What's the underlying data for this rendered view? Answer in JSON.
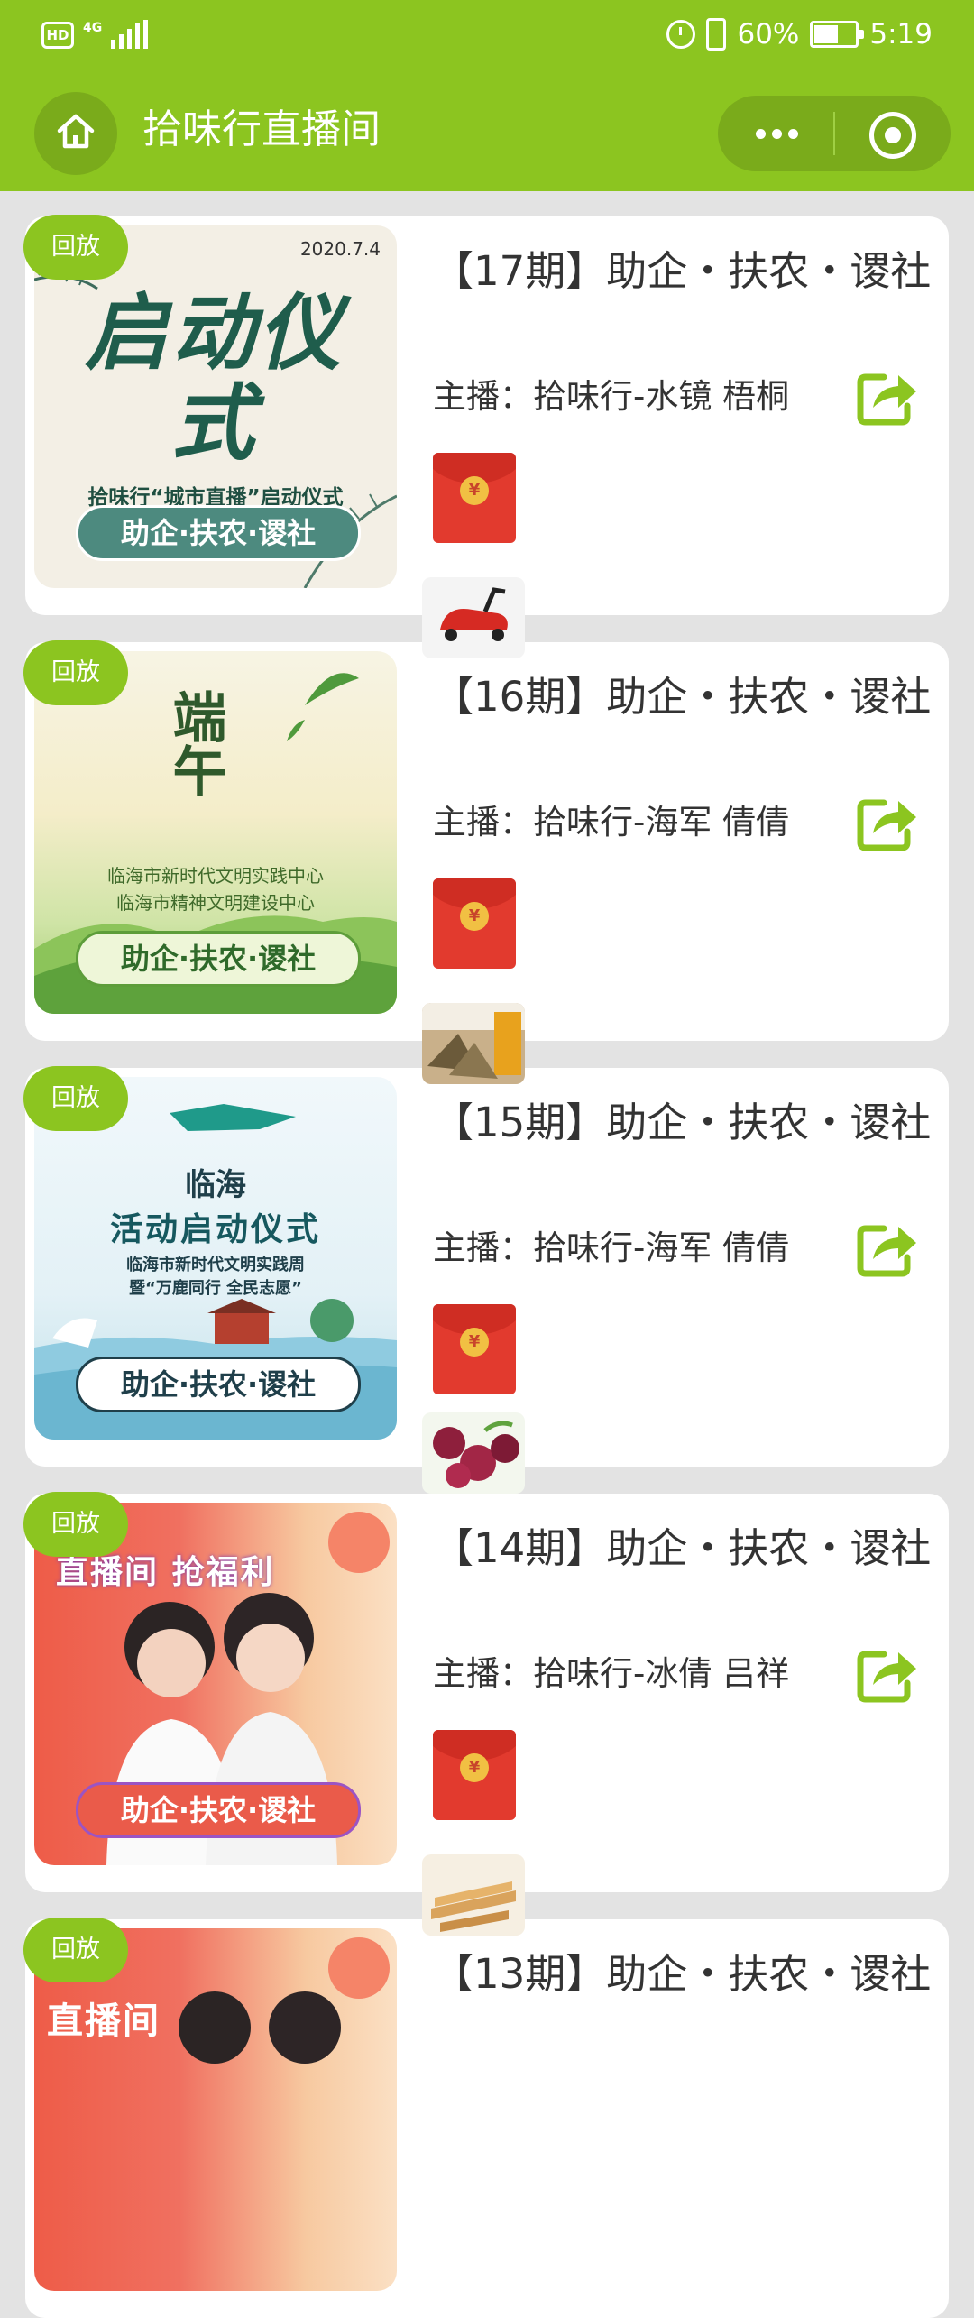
{
  "status_bar": {
    "hd": "HD",
    "network": "4G",
    "battery_percent": "60%",
    "battery_level": 0.6,
    "time": "5:19"
  },
  "nav": {
    "title": "拾味行直播间",
    "home_icon": "home-icon",
    "more_icon": "more-dots-icon",
    "close_icon": "target-close-icon"
  },
  "colors": {
    "brand_green": "#8cc520",
    "capsule_green": "#7aab1b",
    "red_packet": "#e23a2e",
    "background": "#e3e3e3"
  },
  "cards": [
    {
      "replay_label": "回放",
      "title": "【17期】助企・扶农・谡社",
      "host": "主播：拾味行-水镜 梧桐",
      "poster": {
        "date": "2020.7.4",
        "headline": "启动仪式",
        "subheadline": "拾味行“城市直播”启动仪式",
        "banner": "助企·扶农·谡社"
      },
      "share_icon": "share-icon",
      "red_packet_icon": "red-packet-icon",
      "product_icon": "toy-car-product"
    },
    {
      "replay_label": "回放",
      "title": "【16期】助企・扶农・谡社",
      "host": "主播：拾味行-海军 倩倩",
      "poster": {
        "headline": "端午",
        "line1": "临海市新时代文明实践中心",
        "line2": "临海市精神文明建设中心",
        "banner": "助企·扶农·谡社"
      },
      "share_icon": "share-icon",
      "red_packet_icon": "red-packet-icon",
      "product_icon": "zongzi-product"
    },
    {
      "replay_label": "回放",
      "title": "【15期】助企・扶农・谡社",
      "host": "主播：拾味行-海军 倩倩",
      "poster": {
        "city": "临海",
        "headline": "活动启动仪式",
        "line1": "临海市新时代文明实践周",
        "line2": "暨“万鹿同行 全民志愿”",
        "banner": "助企·扶农·谡社"
      },
      "share_icon": "share-icon",
      "red_packet_icon": "red-packet-icon",
      "product_icon": "bayberry-product"
    },
    {
      "replay_label": "回放",
      "title": "【14期】助企・扶农・谡社",
      "host": "主播：拾味行-冰倩 吕祥",
      "poster": {
        "headline": "直播间 抢福利",
        "banner": "助企·扶农·谡社"
      },
      "share_icon": "share-icon",
      "red_packet_icon": "red-packet-icon",
      "product_icon": "snack-product"
    },
    {
      "replay_label": "回放",
      "title": "【13期】助企・扶农・谡社",
      "poster": {
        "headline": "直播间"
      }
    }
  ]
}
